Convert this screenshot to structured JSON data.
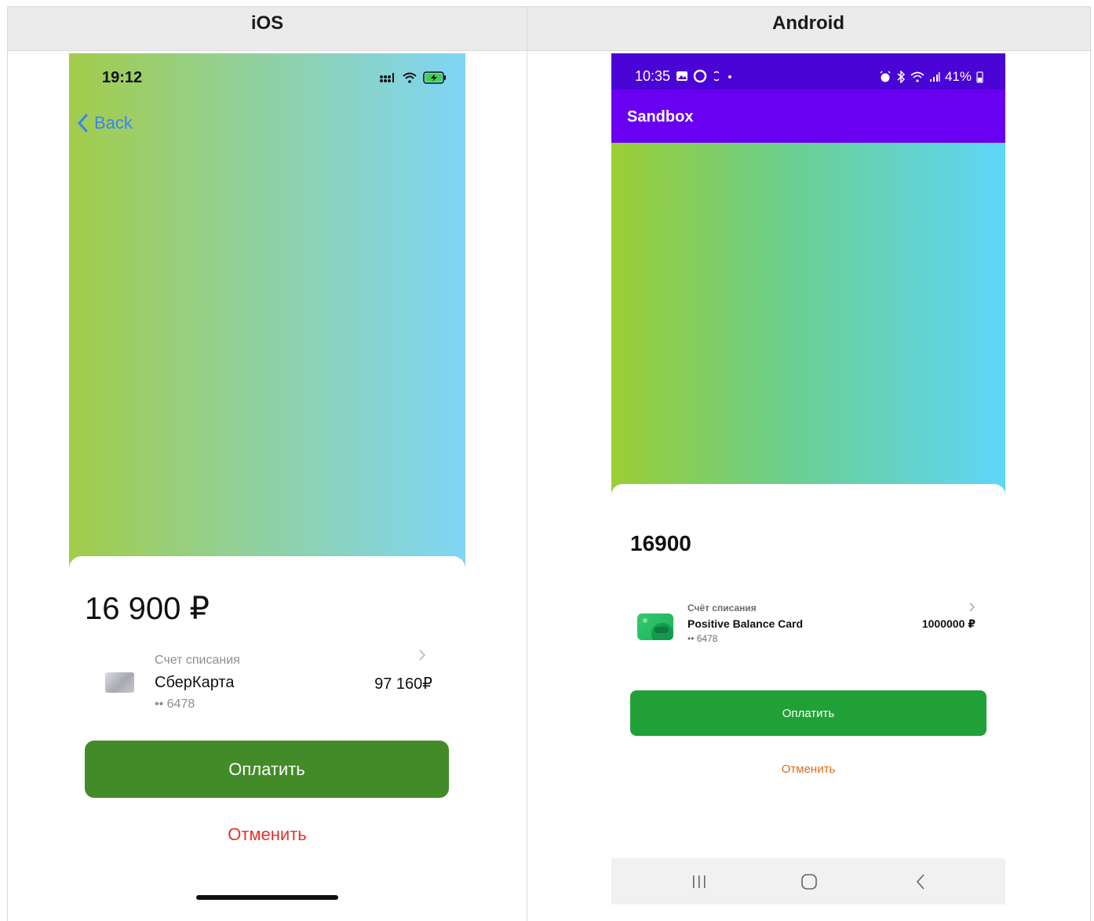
{
  "header": {
    "ios_label": "iOS",
    "android_label": "Android"
  },
  "ios": {
    "status_time": "19:12",
    "back_label": "Back",
    "amount": "16 900 ₽",
    "account_caption": "Счет списания",
    "account_name": "СберКарта",
    "account_number": "•• 6478",
    "account_balance": "97 160₽",
    "pay_label": "Оплатить",
    "cancel_label": "Отменить",
    "colors": {
      "accent": "#438b28",
      "cancel": "#e0342b",
      "link": "#3b82f6"
    }
  },
  "android": {
    "status_time": "10:35",
    "battery": "41%",
    "app_title": "Sandbox",
    "amount": "16900",
    "account_caption": "Счёт списания",
    "account_name": "Positive Balance Card",
    "account_number": "•• 6478",
    "account_balance": "1000000 ₽",
    "pay_label": "Оплатить",
    "cancel_label": "Отменить",
    "colors": {
      "accent": "#21a038",
      "appbar": "#6a00f2",
      "cancel": "#e06b14"
    }
  }
}
